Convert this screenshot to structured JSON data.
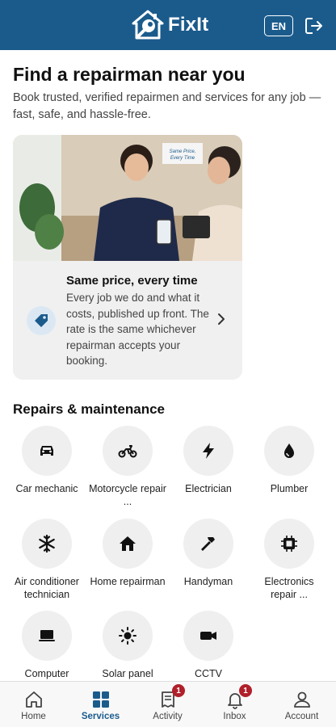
{
  "header": {
    "app_name": "FixIt",
    "language": "EN",
    "logo_icon": "house-wrench-logo",
    "logout_icon": "logout-icon",
    "brand_color": "#1b5b8c"
  },
  "hero": {
    "title": "Find a repairman near you",
    "subtitle": "Book trusted, verified repairmen and services for any job — fast, safe, and hassle-free."
  },
  "promo": {
    "image_sign_text": "Same Price, Every Time",
    "heading": "Same price, every time",
    "body": "Every job we do and what it costs, published up front. The rate is the same whichever repairman accepts your booking.",
    "icon": "price-tag-icon"
  },
  "services_section": {
    "title": "Repairs & maintenance",
    "items": [
      {
        "label": "Car mechanic",
        "icon": "car-icon"
      },
      {
        "label": "Motorcycle repair ...",
        "icon": "motorcycle-icon"
      },
      {
        "label": "Electrician",
        "icon": "lightning-icon"
      },
      {
        "label": "Plumber",
        "icon": "water-drop-icon"
      },
      {
        "label": "Air conditioner technician",
        "icon": "snowflake-icon"
      },
      {
        "label": "Home repairman",
        "icon": "home-icon"
      },
      {
        "label": "Handyman",
        "icon": "hammer-icon"
      },
      {
        "label": "Electronics repair ...",
        "icon": "chip-icon"
      },
      {
        "label": "Computer",
        "icon": "laptop-icon"
      },
      {
        "label": "Solar panel",
        "icon": "sun-icon"
      },
      {
        "label": "CCTV",
        "icon": "video-camera-icon"
      }
    ]
  },
  "bottom_nav": {
    "items": [
      {
        "label": "Home",
        "icon": "home-outline-icon",
        "active": false
      },
      {
        "label": "Services",
        "icon": "grid-icon",
        "active": true
      },
      {
        "label": "Activity",
        "icon": "receipt-icon",
        "active": false,
        "badge": "1"
      },
      {
        "label": "Inbox",
        "icon": "bell-icon",
        "active": false,
        "badge": "1"
      },
      {
        "label": "Account",
        "icon": "person-icon",
        "active": false
      }
    ]
  }
}
